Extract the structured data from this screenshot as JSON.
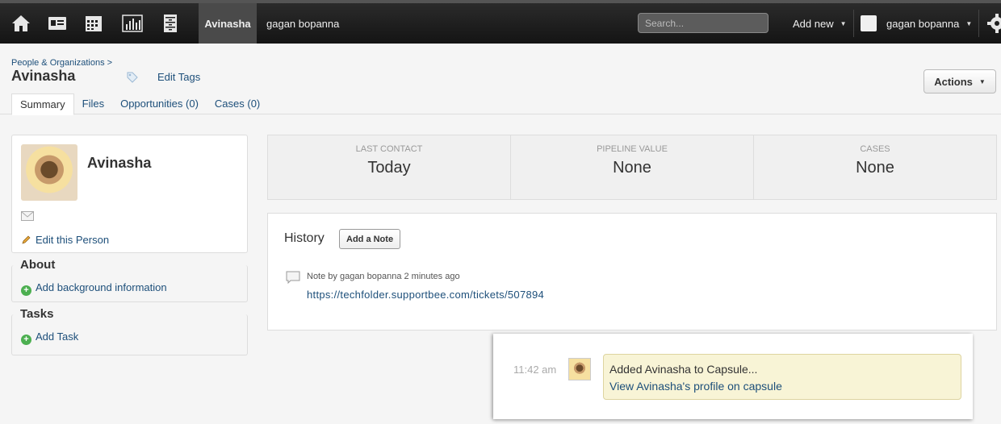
{
  "nav": {
    "icons": [
      "home-icon",
      "contacts-card-icon",
      "calendar-icon",
      "reports-chart-icon",
      "cabinet-icon"
    ],
    "tabs": [
      {
        "label": "Avinasha",
        "active": true
      },
      {
        "label": "gagan bopanna",
        "active": false
      }
    ],
    "search_placeholder": "Search...",
    "add_new": "Add new",
    "user_name": "gagan bopanna"
  },
  "header": {
    "breadcrumb": "People & Organizations >",
    "title": "Avinasha",
    "edit_tags": "Edit Tags",
    "actions": "Actions",
    "tabs": [
      "Summary",
      "Files",
      "Opportunities (0)",
      "Cases (0)"
    ]
  },
  "profile": {
    "name": "Avinasha",
    "edit_link": "Edit this Person"
  },
  "about": {
    "title": "About",
    "add_link": "Add background information"
  },
  "tasks": {
    "title": "Tasks",
    "add_link": "Add Task"
  },
  "stats": [
    {
      "label": "Last Contact",
      "value": "Today"
    },
    {
      "label": "Pipeline Value",
      "value": "None"
    },
    {
      "label": "Cases",
      "value": "None"
    }
  ],
  "history": {
    "title": "History",
    "add_note": "Add a Note",
    "note_meta": "Note by gagan bopanna 2 minutes ago",
    "note_link": "https://techfolder.supportbee.com/tickets/507894"
  },
  "notification": {
    "time": "11:42 am",
    "text": "Added Avinasha to Capsule...",
    "link": "View Avinasha's profile on capsule"
  },
  "colors": {
    "link": "#1d4f7a",
    "topbar": "#1e1e1e",
    "notify_bg": "#f8f4d6",
    "plus_green": "#4caf50"
  }
}
